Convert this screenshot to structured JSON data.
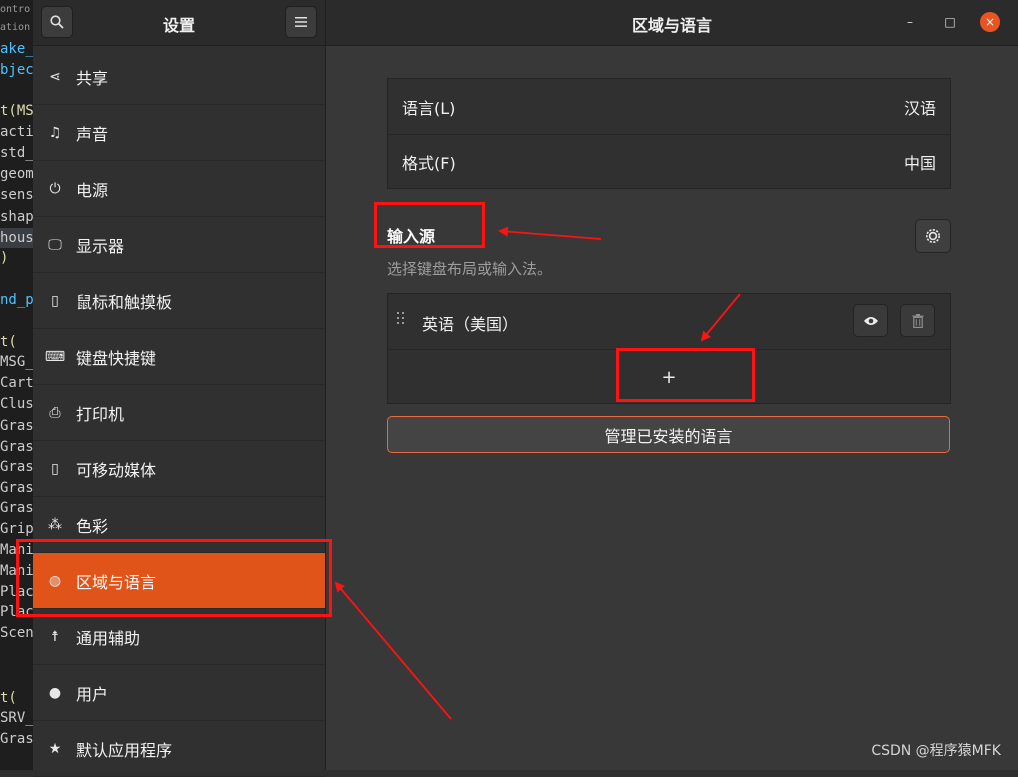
{
  "background_code": {
    "lines": [
      {
        "text": "ontro",
        "style": "tiny"
      },
      {
        "text": "ation",
        "style": "tiny"
      },
      {
        "text": "ake_",
        "style": "blue"
      },
      {
        "text": "bjec",
        "style": "blue"
      },
      {
        "text": "",
        "style": ""
      },
      {
        "text": "t(MS",
        "style": "yellow"
      },
      {
        "text": "acti",
        "style": ""
      },
      {
        "text": "std_",
        "style": ""
      },
      {
        "text": "geom",
        "style": ""
      },
      {
        "text": "sens",
        "style": ""
      },
      {
        "text": "shap",
        "style": ""
      },
      {
        "text": "hous",
        "style": "hl"
      },
      {
        "text": ")",
        "style": "yellow"
      },
      {
        "text": "",
        "style": ""
      },
      {
        "text": "nd_p",
        "style": "blue"
      },
      {
        "text": "",
        "style": ""
      },
      {
        "text": "t(",
        "style": "yellow"
      },
      {
        "text": "MSG_",
        "style": ""
      },
      {
        "text": "Cart",
        "style": ""
      },
      {
        "text": "Clus",
        "style": ""
      },
      {
        "text": "Gras",
        "style": ""
      },
      {
        "text": "Gras",
        "style": ""
      },
      {
        "text": "Gras",
        "style": ""
      },
      {
        "text": "Gras",
        "style": ""
      },
      {
        "text": "Gras",
        "style": ""
      },
      {
        "text": "Grip",
        "style": ""
      },
      {
        "text": "Mani",
        "style": ""
      },
      {
        "text": "Mani",
        "style": ""
      },
      {
        "text": "Plac",
        "style": ""
      },
      {
        "text": "Plac",
        "style": ""
      },
      {
        "text": "Scen",
        "style": ""
      },
      {
        "text": "",
        "style": ""
      },
      {
        "text": "",
        "style": ""
      },
      {
        "text": "t(",
        "style": "yellow"
      },
      {
        "text": "SRV_",
        "style": ""
      },
      {
        "text": "Gras",
        "style": ""
      }
    ]
  },
  "sidebar": {
    "title": "设置",
    "search_icon": "search-icon",
    "menu_icon": "hamburger-menu-icon",
    "items": [
      {
        "label": "共享",
        "icon": "share-icon",
        "glyph": "⋖"
      },
      {
        "label": "声音",
        "icon": "music-note-icon",
        "glyph": "♫"
      },
      {
        "label": "电源",
        "icon": "power-icon",
        "glyph": "⏻"
      },
      {
        "label": "显示器",
        "icon": "monitor-icon",
        "glyph": "🖵"
      },
      {
        "label": "鼠标和触摸板",
        "icon": "mouse-icon",
        "glyph": "▯"
      },
      {
        "label": "键盘快捷键",
        "icon": "keyboard-icon",
        "glyph": "⌨"
      },
      {
        "label": "打印机",
        "icon": "printer-icon",
        "glyph": "⎙"
      },
      {
        "label": "可移动媒体",
        "icon": "removable-media-icon",
        "glyph": "▯"
      },
      {
        "label": "色彩",
        "icon": "color-icon",
        "glyph": "⁂"
      },
      {
        "label": "区域与语言",
        "icon": "globe-icon",
        "glyph": "◍",
        "active": true
      },
      {
        "label": "通用辅助",
        "icon": "accessibility-icon",
        "glyph": "☨"
      },
      {
        "label": "用户",
        "icon": "user-icon",
        "glyph": "●"
      },
      {
        "label": "默认应用程序",
        "icon": "star-icon",
        "glyph": "★"
      }
    ]
  },
  "main": {
    "title": "区域与语言",
    "window_controls": {
      "minimize": "–",
      "maximize": "□",
      "close": "×"
    },
    "settings_rows": [
      {
        "label": "语言(L)",
        "value": "汉语"
      },
      {
        "label": "格式(F)",
        "value": "中国"
      }
    ],
    "input_sources": {
      "title": "输入源",
      "subtitle": "选择键盘布局或输入法。",
      "sources": [
        {
          "label": "英语（美国）"
        }
      ],
      "add_label": "+"
    },
    "manage_button": "管理已安装的语言"
  },
  "watermark": "CSDN @程序猿MFK",
  "colors": {
    "accent": "#e05319",
    "annotation": "#ff1212"
  }
}
